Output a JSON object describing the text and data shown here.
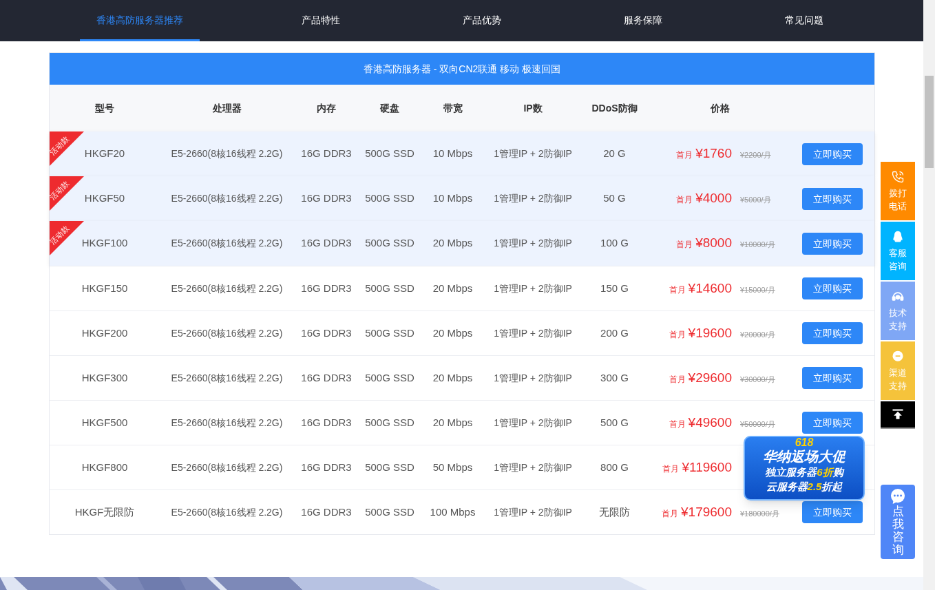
{
  "nav": {
    "tabs": [
      {
        "label": "香港高防服务器推荐",
        "selected": true
      },
      {
        "label": "产品特性",
        "selected": false
      },
      {
        "label": "产品优势",
        "selected": false
      },
      {
        "label": "服务保障",
        "selected": false
      },
      {
        "label": "常见问题",
        "selected": false
      }
    ]
  },
  "table": {
    "title": "香港高防服务器 - 双向CN2联通 移动 极速回国",
    "columns": [
      "型号",
      "处理器",
      "内存",
      "硬盘",
      "带宽",
      "IP数",
      "DDoS防御",
      "价格"
    ],
    "rows": [
      {
        "badge": "活动款",
        "highlighted": true,
        "model": "HKGF20",
        "cpu": "E5-2660(8核16线程 2.2G)",
        "memory": "16G DDR3",
        "disk": "500G SSD",
        "bandwidth": "10 Mbps",
        "ip": "1管理IP + 2防御IP",
        "ddos": "20 G",
        "price_label": "首月",
        "price": "¥1760",
        "old_price": "¥2200/月",
        "button": "立即购买"
      },
      {
        "badge": "活动款",
        "highlighted": true,
        "model": "HKGF50",
        "cpu": "E5-2660(8核16线程 2.2G)",
        "memory": "16G DDR3",
        "disk": "500G SSD",
        "bandwidth": "10 Mbps",
        "ip": "1管理IP + 2防御IP",
        "ddos": "50 G",
        "price_label": "首月",
        "price": "¥4000",
        "old_price": "¥5000/月",
        "button": "立即购买"
      },
      {
        "badge": "活动款",
        "highlighted": true,
        "model": "HKGF100",
        "cpu": "E5-2660(8核16线程 2.2G)",
        "memory": "16G DDR3",
        "disk": "500G SSD",
        "bandwidth": "20 Mbps",
        "ip": "1管理IP + 2防御IP",
        "ddos": "100 G",
        "price_label": "首月",
        "price": "¥8000",
        "old_price": "¥10000/月",
        "button": "立即购买"
      },
      {
        "highlighted": false,
        "model": "HKGF150",
        "cpu": "E5-2660(8核16线程 2.2G)",
        "memory": "16G DDR3",
        "disk": "500G SSD",
        "bandwidth": "20 Mbps",
        "ip": "1管理IP + 2防御IP",
        "ddos": "150 G",
        "price_label": "首月",
        "price": "¥14600",
        "old_price": "¥15000/月",
        "button": "立即购买"
      },
      {
        "highlighted": false,
        "model": "HKGF200",
        "cpu": "E5-2660(8核16线程 2.2G)",
        "memory": "16G DDR3",
        "disk": "500G SSD",
        "bandwidth": "20 Mbps",
        "ip": "1管理IP + 2防御IP",
        "ddos": "200 G",
        "price_label": "首月",
        "price": "¥19600",
        "old_price": "¥20000/月",
        "button": "立即购买"
      },
      {
        "highlighted": false,
        "model": "HKGF300",
        "cpu": "E5-2660(8核16线程 2.2G)",
        "memory": "16G DDR3",
        "disk": "500G SSD",
        "bandwidth": "20 Mbps",
        "ip": "1管理IP + 2防御IP",
        "ddos": "300 G",
        "price_label": "首月",
        "price": "¥29600",
        "old_price": "¥30000/月",
        "button": "立即购买"
      },
      {
        "highlighted": false,
        "model": "HKGF500",
        "cpu": "E5-2660(8核16线程 2.2G)",
        "memory": "16G DDR3",
        "disk": "500G SSD",
        "bandwidth": "20 Mbps",
        "ip": "1管理IP + 2防御IP",
        "ddos": "500 G",
        "price_label": "首月",
        "price": "¥49600",
        "old_price": "¥50000/月",
        "button": "立即购买"
      },
      {
        "highlighted": false,
        "model": "HKGF800",
        "cpu": "E5-2660(8核16线程 2.2G)",
        "memory": "16G DDR3",
        "disk": "500G SSD",
        "bandwidth": "50 Mbps",
        "ip": "1管理IP + 2防御IP",
        "ddos": "800 G",
        "price_label": "首月",
        "price": "¥119600"
      },
      {
        "highlighted": false,
        "model": "HKGF无限防",
        "cpu": "E5-2660(8核16线程 2.2G)",
        "memory": "16G DDR3",
        "disk": "500G SSD",
        "bandwidth": "100 Mbps",
        "ip": "1管理IP + 2防御IP",
        "ddos": "无限防",
        "price_label": "首月",
        "price": "¥179600",
        "old_price": "¥180000/月",
        "button": "立即购买"
      }
    ]
  },
  "side_buttons": [
    {
      "kind": "phone",
      "label": "拨打电话",
      "color": "#ff8a00"
    },
    {
      "kind": "chat",
      "label": "客服咨询",
      "color": "#00b4ff"
    },
    {
      "kind": "support",
      "label": "技术支持",
      "color": "#7fa7f5"
    },
    {
      "kind": "channel",
      "label": "渠道支持",
      "color": "#f5c33b"
    },
    {
      "kind": "top",
      "color": "#000000"
    }
  ],
  "promo": {
    "tag": "618",
    "title": "华纳返场大促",
    "lines": [
      "独立服务器**6折**购",
      "云服务器**2.5**折起"
    ]
  },
  "consult_button": {
    "label": "点我咨询"
  }
}
